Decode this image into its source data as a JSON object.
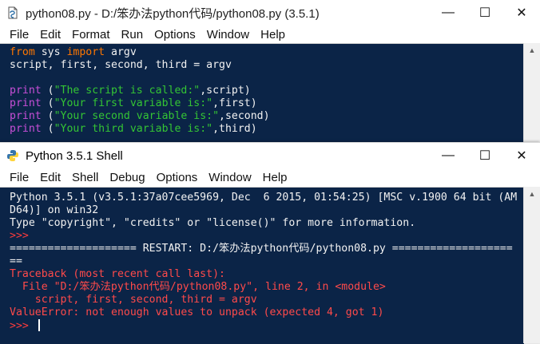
{
  "editor": {
    "title": "python08.py - D:/笨办法python代码/python08.py (3.5.1)",
    "menu": [
      "File",
      "Edit",
      "Format",
      "Run",
      "Options",
      "Window",
      "Help"
    ],
    "code": {
      "l1_kw1": "from",
      "l1_mod": " sys ",
      "l1_kw2": "import",
      "l1_rest": " argv",
      "l2": "script, first, second, third = argv",
      "l3": "",
      "p1_fn": "print",
      "p1_open": " (",
      "p1_str": "\"The script is called:\"",
      "p1_rest": ",script)",
      "p2_fn": "print",
      "p2_open": " (",
      "p2_str": "\"Your first variable is:\"",
      "p2_rest": ",first)",
      "p3_fn": "print",
      "p3_open": " (",
      "p3_str": "\"Your second variable is:\"",
      "p3_rest": ",second)",
      "p4_fn": "print",
      "p4_open": " (",
      "p4_str": "\"Your third variable is:\"",
      "p4_rest": ",third)"
    }
  },
  "shell": {
    "title": "Python 3.5.1 Shell",
    "menu": [
      "File",
      "Edit",
      "Shell",
      "Debug",
      "Options",
      "Window",
      "Help"
    ],
    "output": {
      "banner1": "Python 3.5.1 (v3.5.1:37a07cee5969, Dec  6 2015, 01:54:25) [MSC v.1900 64 bit (AM",
      "banner2": "D64)] on win32",
      "banner3": "Type \"copyright\", \"credits\" or \"license()\" for more information.",
      "prompt1": ">>> ",
      "restart1": "==================== RESTART: D:/笨办法python代码/python08.py ===================",
      "restart2": "==",
      "tb1": "Traceback (most recent call last):",
      "tb2": "  File \"D:/笨办法python代码/python08.py\", line 2, in <module>",
      "tb3": "    script, first, second, third = argv",
      "tb4": "ValueError: not enough values to unpack (expected 4, got 1)",
      "prompt2": ">>> "
    }
  },
  "window_buttons": {
    "minimize": "—",
    "maximize": "☐",
    "close": "✕"
  },
  "scroll": {
    "up": "▲",
    "down": "▼"
  }
}
